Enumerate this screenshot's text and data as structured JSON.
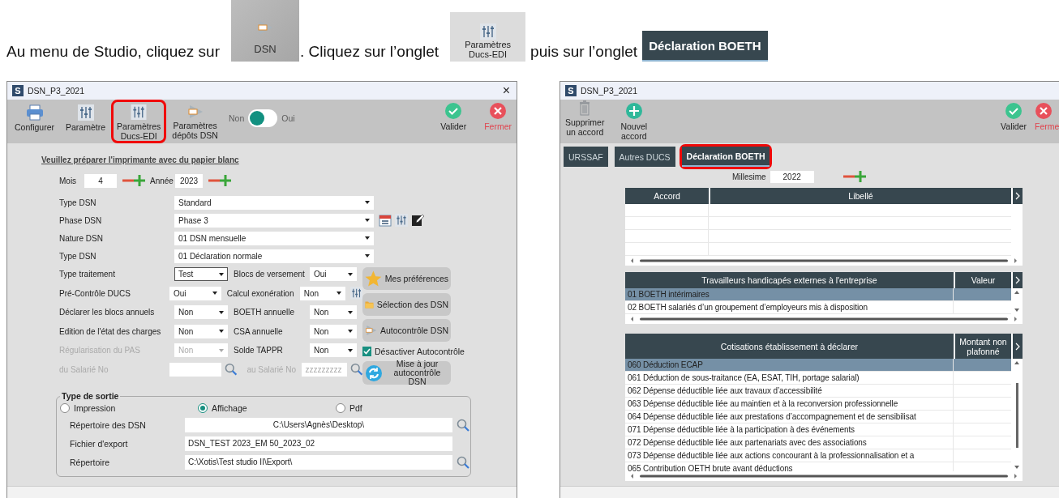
{
  "instruction": {
    "text_before": "Au menu de Studio, cliquez sur",
    "dsn_button": "DSN",
    "text_middle": ". Cliquez sur l’onglet",
    "params_button": [
      "Paramètres",
      "Ducs-EDI"
    ],
    "text_after": "puis sur l’onglet",
    "boeth_tab": "Déclaration BOETH"
  },
  "left_window": {
    "app_icon": "S",
    "title": "DSN_P3_2021",
    "close": "×",
    "toolbar": [
      {
        "kind": "printer",
        "lines": [
          "Configurer"
        ],
        "highlighted": false
      },
      {
        "kind": "sliders",
        "lines": [
          "Paramètre"
        ],
        "highlighted": false
      },
      {
        "kind": "sliders",
        "lines": [
          "Paramètres",
          "Ducs-EDI"
        ],
        "highlighted": true
      },
      {
        "kind": "dsn",
        "lines": [
          "Paramètres",
          "dépôts DSN"
        ],
        "highlighted": false
      },
      {
        "kind": "toggle",
        "off_label": "Non",
        "on_label": "Oui",
        "on": false
      },
      {
        "kind": "validate",
        "lines": [
          "Valider"
        ]
      },
      {
        "kind": "close",
        "lines": [
          "Fermer"
        ]
      }
    ],
    "notice": "Veuillez préparer l'imprimante avec du papier blanc",
    "period": {
      "month_label": "Mois",
      "month": "4",
      "year_label": "Année",
      "year": "2023"
    },
    "selects": [
      {
        "label": "Type DSN",
        "value": "Standard",
        "tools": false
      },
      {
        "label": "Phase DSN",
        "value": "Phase 3",
        "tools": true
      },
      {
        "label": "Nature DSN",
        "value": "01 DSN mensuelle",
        "tools": false
      },
      {
        "label": "Type DSN",
        "value": "01 Déclaration normale",
        "tools": false
      }
    ],
    "options": [
      {
        "kind": "pair",
        "label": "Type traitement",
        "value": "Test",
        "focused": true,
        "disabled": false,
        "label_2": "Blocs de versement",
        "value_2": "Oui",
        "tool": false
      },
      {
        "kind": "pair",
        "label": "Pré-Contrôle DUCS",
        "value": "Oui",
        "focused": false,
        "disabled": false,
        "label_2": "Calcul exonération",
        "value_2": "Non",
        "tool": true
      },
      {
        "kind": "pair",
        "label": "Déclarer les blocs annuels",
        "value": "Non",
        "focused": false,
        "disabled": false,
        "label_2": "BOETH annuelle",
        "value_2": "Non",
        "tool": false
      },
      {
        "kind": "pair",
        "label": "Edition de l'état des charges",
        "value": "Non",
        "focused": false,
        "disabled": false,
        "label_2": "CSA annuelle",
        "value_2": "Non",
        "tool": false
      },
      {
        "kind": "pair",
        "label": "Régularisation du PAS",
        "value": "Non",
        "focused": false,
        "disabled": true,
        "label_2": "Solde TAPPR",
        "value_2": "Non",
        "tool": false
      },
      {
        "kind": "range",
        "label": "du Salarié No",
        "label_2": "au Salarié No",
        "value_2": "zzzzzzzzz",
        "disabled": true
      }
    ],
    "side_buttons": [
      {
        "kind": "star",
        "label": "Mes préférences"
      },
      {
        "kind": "folder",
        "label": "Sélection des DSN"
      },
      {
        "kind": "dsn",
        "label": "Autocontrôle DSN"
      },
      {
        "kind": "checkbox",
        "label": "Désactiver Autocontrôle",
        "checked": true
      },
      {
        "kind": "refresh",
        "label": "Mise à jour autocontrôle DSN"
      }
    ],
    "output": {
      "legend": "Type de sortie",
      "modes": [
        {
          "label": "Impression",
          "selected": false
        },
        {
          "label": "Affichage",
          "selected": true
        },
        {
          "label": "Pdf",
          "selected": false
        }
      ],
      "fields": [
        {
          "label": "Répertoire des DSN",
          "value": "C:\\Users\\Agnès\\Desktop\\",
          "browse": true
        },
        {
          "label": "Fichier d'export",
          "value": "DSN_TEST 2023_EM 50_2023_02",
          "browse": false
        },
        {
          "label": "Répertoire",
          "value": "C:\\Xotis\\Test studio II\\Export\\",
          "browse": true
        }
      ]
    }
  },
  "right_window": {
    "app_icon": "S",
    "title": "DSN_P3_2021",
    "toolbar": [
      {
        "kind": "trash",
        "lines": [
          "Supprimer",
          "un accord"
        ]
      },
      {
        "kind": "add",
        "lines": [
          "Nouvel",
          "accord"
        ]
      },
      {
        "kind": "validate",
        "lines": [
          "Valider"
        ]
      },
      {
        "kind": "close",
        "lines": [
          "Ferme"
        ]
      }
    ],
    "tabs": [
      {
        "label": "URSSAF",
        "selected": false,
        "highlighted": false
      },
      {
        "label": "Autres DUCS",
        "selected": false,
        "highlighted": false
      },
      {
        "label": "Déclaration BOETH",
        "selected": true,
        "highlighted": true
      }
    ],
    "vintage": {
      "label": "Millesime",
      "value": "2022"
    },
    "tables": [
      {
        "columns": [
          "Accord",
          "Libellé"
        ]
      },
      {
        "columns": [
          "Travailleurs handicapés externes à l'entreprise",
          "Valeur"
        ],
        "rows": [
          {
            "label": "01 BOETH intérimaires",
            "selected": true
          },
          {
            "label": "02 BOETH salariés d’un groupement d’employeurs mis à disposition",
            "selected": false
          }
        ]
      },
      {
        "columns": [
          "Cotisations établissement à déclarer",
          "Montant non plafonné"
        ],
        "rows": [
          {
            "label": "060 Déduction ECAP",
            "selected": true
          },
          {
            "label": "061 Déduction de sous-traitance (EA, ESAT, TIH, portage salarial)",
            "selected": false
          },
          {
            "label": "062 Dépense déductible liée aux travaux d’accessibilité",
            "selected": false
          },
          {
            "label": "063 Dépense déductible liée au maintien et à la reconversion professionnelle",
            "selected": false
          },
          {
            "label": "064 Dépense déductible liée aux prestations d’accompagnement et de sensibilisat",
            "selected": false
          },
          {
            "label": "071 Dépense déductible liée à la participation à des événements",
            "selected": false
          },
          {
            "label": "072 Dépense déductible liée aux partenariats avec des associations",
            "selected": false
          },
          {
            "label": "073 Dépense déductible liée aux actions concourant à la professionnalisation et a",
            "selected": false
          },
          {
            "label": "065 Contribution OETH brute avant déductions",
            "selected": false
          }
        ]
      }
    ]
  }
}
